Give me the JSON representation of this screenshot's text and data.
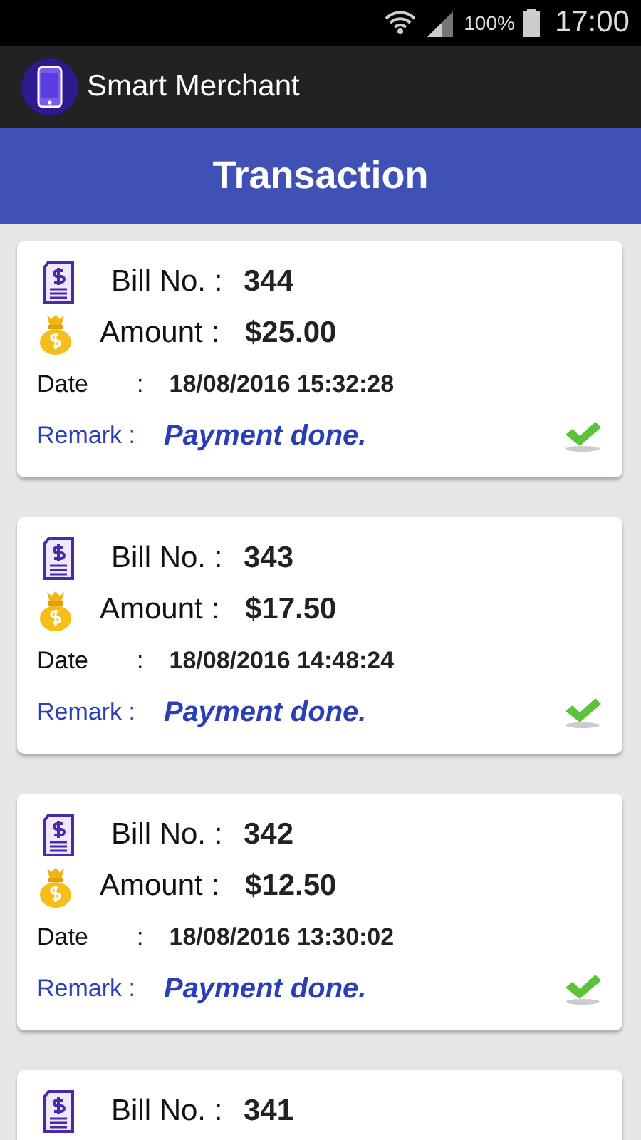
{
  "status_bar": {
    "battery": "100%",
    "time": "17:00"
  },
  "app_bar": {
    "title": "Smart Merchant"
  },
  "header": {
    "title": "Transaction"
  },
  "transactions": [
    {
      "bill_label": "Bill No. :",
      "bill_no": "344",
      "amount_label": "Amount :",
      "amount": "$25.00",
      "date_label": "Date",
      "date_sep": ":",
      "date": "18/08/2016 15:32:28",
      "remark_label": "Remark :",
      "remark": "Payment done.",
      "done": true
    },
    {
      "bill_label": "Bill No. :",
      "bill_no": "343",
      "amount_label": "Amount :",
      "amount": "$17.50",
      "date_label": "Date",
      "date_sep": ":",
      "date": "18/08/2016 14:48:24",
      "remark_label": "Remark :",
      "remark": "Payment done.",
      "done": true
    },
    {
      "bill_label": "Bill No. :",
      "bill_no": "342",
      "amount_label": "Amount :",
      "amount": "$12.50",
      "date_label": "Date",
      "date_sep": ":",
      "date": "18/08/2016 13:30:02",
      "remark_label": "Remark :",
      "remark": "Payment done.",
      "done": true
    },
    {
      "bill_label": "Bill No. :",
      "bill_no": "341"
    }
  ]
}
